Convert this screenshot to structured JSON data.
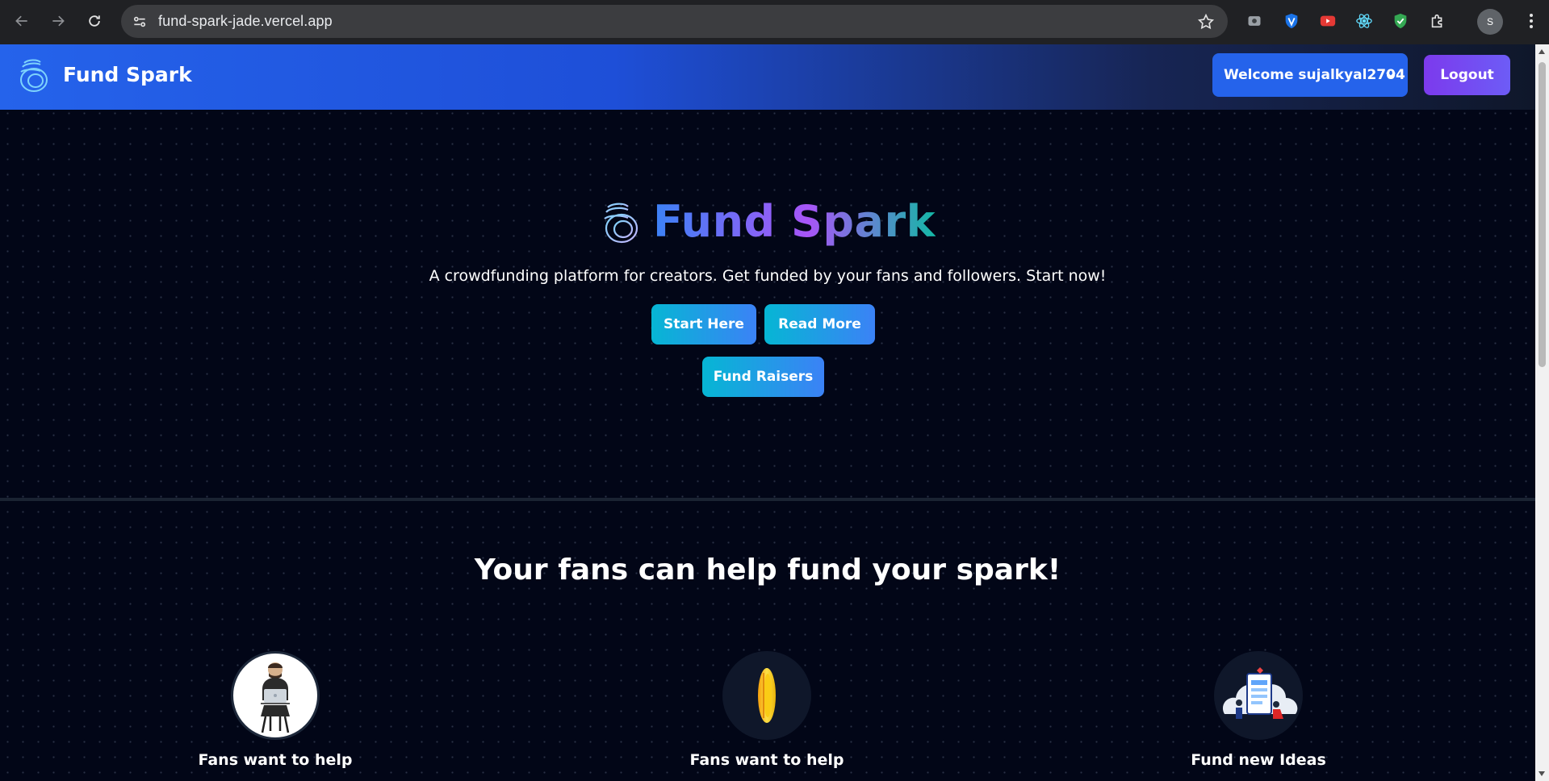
{
  "browser": {
    "url": "fund-spark-jade.vercel.app",
    "profile_initial": "S"
  },
  "nav": {
    "brand": "Fund Spark",
    "welcome": "Welcome sujalkyal2704",
    "logout": "Logout"
  },
  "hero": {
    "title": "Fund Spark",
    "tagline": "A crowdfunding platform for creators. Get funded by your fans and followers. Start now!",
    "buttons": {
      "start": "Start Here",
      "read": "Read More",
      "raisers": "Fund Raisers"
    }
  },
  "features": {
    "heading": "Your fans can help fund your spark!",
    "items": [
      {
        "label": "Fans want to help",
        "icon": "man-with-laptop-icon"
      },
      {
        "label": "Fans want to help",
        "icon": "coin-icon"
      },
      {
        "label": "Fund new Ideas",
        "icon": "ideas-illustration-icon"
      }
    ]
  },
  "colors": {
    "background": "#020617",
    "nav_gradient_start": "#2563eb",
    "primary_button": "#2563eb",
    "logout_gradient": "#7c3aed",
    "cta_gradient_start": "#06b6d4",
    "cta_gradient_end": "#3b82f6"
  }
}
